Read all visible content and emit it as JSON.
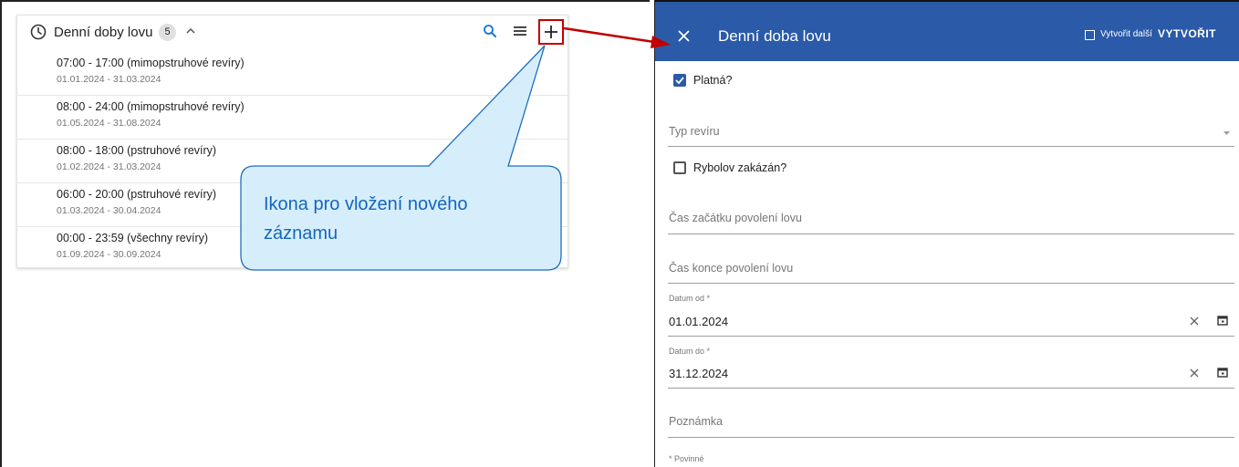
{
  "list_panel": {
    "title": "Denní doby lovu",
    "count": "5",
    "records": [
      {
        "title": "07:00 - 17:00 (mimopstruhové revíry)",
        "dates": "01.01.2024 - 31.03.2024"
      },
      {
        "title": "08:00 - 24:00 (mimopstruhové revíry)",
        "dates": "01.05.2024 - 31.08.2024"
      },
      {
        "title": "08:00 - 18:00 (pstruhové revíry)",
        "dates": "01.02.2024 - 31.03.2024"
      },
      {
        "title": "06:00 - 20:00 (pstruhové revíry)",
        "dates": "01.03.2024 - 30.04.2024"
      },
      {
        "title": "00:00 - 23:59 (všechny revíry)",
        "dates": "01.09.2024 - 30.09.2024"
      }
    ],
    "icons": [
      "clock-icon",
      "chevron-up-icon",
      "search-icon",
      "menu-icon",
      "plus-icon"
    ]
  },
  "annotation": {
    "callout_line1": "Ikona pro vložení nového",
    "callout_line2": "záznamu"
  },
  "dialog": {
    "title": "Denní doba lovu",
    "create_another_label": "Vytvořit další",
    "create_button": "VYTVOŘIT",
    "valid_label": "Platná?",
    "valid_checked": true,
    "revir_type_placeholder": "Typ revíru",
    "fishing_banned_label": "Rybolov zakázán?",
    "fishing_banned_checked": false,
    "start_time_placeholder": "Čas začátku povolení lovu",
    "end_time_placeholder": "Čas konce povolení lovu",
    "date_from_label": "Datum od *",
    "date_from_value": "01.01.2024",
    "date_to_label": "Datum do *",
    "date_to_value": "31.12.2024",
    "note_placeholder": "Poznámka",
    "required_note": "* Povinné"
  },
  "colors": {
    "header_blue": "#2a5aa8",
    "highlight_red": "#c00000",
    "arrow_red": "#c00000",
    "callout_fill": "#d6eefb",
    "callout_border": "#1f6fbf",
    "callout_text": "#1565c0"
  }
}
